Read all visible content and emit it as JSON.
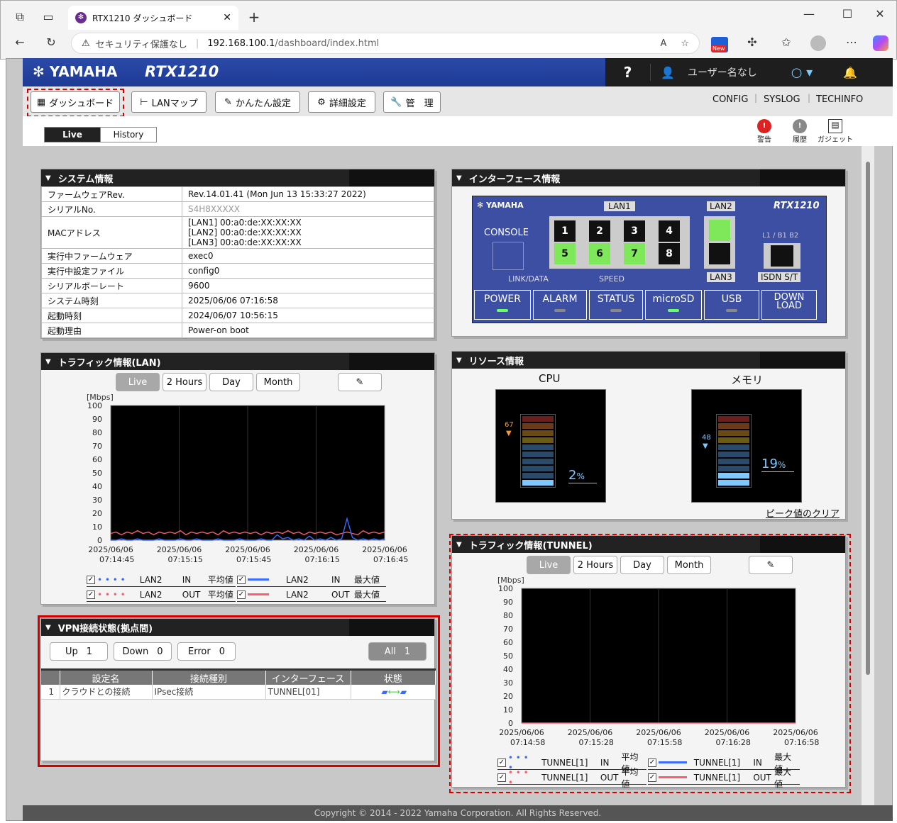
{
  "browser": {
    "tab_title": "RTX1210 ダッシュボード",
    "security": "セキュリティ保護なし",
    "url_host": "192.168.100.1",
    "url_path": "/dashboard/index.html",
    "new_badge": "New"
  },
  "header": {
    "brand": "YAMAHA",
    "model": "RTX1210",
    "help": "?",
    "user": "ユーザー名なし"
  },
  "nav": {
    "dashboard": "ダッシュボード",
    "lanmap": "LANマップ",
    "easy": "かんたん設定",
    "detail": "詳細設定",
    "manage": "管　理",
    "config": "CONFIG",
    "syslog": "SYSLOG",
    "techinfo": "TECHINFO"
  },
  "mode": {
    "live": "Live",
    "history": "History"
  },
  "tools": {
    "alert": "警告",
    "history": "履歴",
    "gadget": "ガジェット"
  },
  "system": {
    "title": "システム情報",
    "rows": [
      {
        "k": "ファームウェアRev.",
        "v": "Rev.14.01.41 (Mon Jun 13 15:33:27 2022)"
      },
      {
        "k": "シリアルNo.",
        "v": "S4H8XXXXX"
      },
      {
        "k": "MACアドレス",
        "v1": "[LAN1] 00:a0:de:XX:XX:XX",
        "v2": "[LAN2] 00:a0:de:XX:XX:XX",
        "v3": "[LAN3] 00:a0:de:XX:XX:XX"
      },
      {
        "k": "実行中ファームウェア",
        "v": "exec0"
      },
      {
        "k": "実行中設定ファイル",
        "v": "config0"
      },
      {
        "k": "シリアルボーレート",
        "v": "9600"
      },
      {
        "k": "システム時刻",
        "v": "2025/06/06 07:16:58"
      },
      {
        "k": "起動時刻",
        "v": "2024/06/07 10:56:15"
      },
      {
        "k": "起動理由",
        "v": "Power-on boot"
      }
    ]
  },
  "iface": {
    "title": "インターフェース情報",
    "brand": "YAMAHA",
    "model": "RTX1210",
    "console": "CONSOLE",
    "lan1": "LAN1",
    "lan2": "LAN2",
    "lan3": "LAN3",
    "isdn": "ISDN S/T",
    "l1": "L1 / B1 B2",
    "linkdata": "LINK/DATA",
    "speed": "SPEED",
    "ports": [
      "1",
      "2",
      "3",
      "4",
      "5",
      "6",
      "7",
      "8"
    ],
    "status": [
      {
        "n": "POWER",
        "on": true
      },
      {
        "n": "ALARM",
        "on": false
      },
      {
        "n": "STATUS",
        "on": false
      },
      {
        "n": "microSD",
        "on": true
      },
      {
        "n": "USB",
        "on": false
      },
      {
        "n": "DOWN LOAD",
        "on": false
      }
    ]
  },
  "traffic_lan": {
    "title": "トラフィック情報(LAN)",
    "btns": [
      "Live",
      "2 Hours",
      "Day",
      "Month"
    ],
    "unit": "[Mbps]",
    "legend": [
      {
        "a": "LAN2",
        "b": "IN",
        "c": "平均値"
      },
      {
        "a": "LAN2",
        "b": "IN",
        "c": "最大値"
      },
      {
        "a": "LAN2",
        "b": "OUT",
        "c": "平均値"
      },
      {
        "a": "LAN2",
        "b": "OUT",
        "c": "最大値"
      }
    ]
  },
  "traffic_tunnel": {
    "title": "トラフィック情報(TUNNEL)",
    "btns": [
      "Live",
      "2 Hours",
      "Day",
      "Month"
    ],
    "unit": "[Mbps]",
    "legend": [
      {
        "a": "TUNNEL[1]",
        "b": "IN",
        "c": "平均値"
      },
      {
        "a": "TUNNEL[1]",
        "b": "IN",
        "c": "最大値"
      },
      {
        "a": "TUNNEL[1]",
        "b": "OUT",
        "c": "平均値"
      },
      {
        "a": "TUNNEL[1]",
        "b": "OUT",
        "c": "最大値"
      }
    ]
  },
  "resource": {
    "title": "リソース情報",
    "cpu": "CPU",
    "mem": "メモリ",
    "cpu_peak": "67",
    "cpu_val": "2",
    "mem_peak": "48",
    "mem_val": "19",
    "pct": "%",
    "clear": "ピーク値のクリア"
  },
  "vpn": {
    "title": "VPN接続状態(拠点間)",
    "up": "Up",
    "up_n": "1",
    "down": "Down",
    "down_n": "0",
    "err": "Error",
    "err_n": "0",
    "all": "All",
    "all_n": "1",
    "cols": [
      "設定名",
      "接続種別",
      "インターフェース",
      "状態"
    ],
    "rows": [
      {
        "no": "1",
        "name": "クラウドとの接続",
        "type": "IPsec接続",
        "iface": "TUNNEL[01]"
      }
    ]
  },
  "footer": "Copyright © 2014 - 2022 Yamaha Corporation. All Rights Reserved.",
  "chart_data": [
    {
      "type": "line",
      "title": "トラフィック情報(LAN)",
      "ylabel": "[Mbps]",
      "ylim": [
        0,
        100
      ],
      "yticks": [
        0,
        10,
        20,
        30,
        40,
        50,
        60,
        70,
        80,
        90,
        100
      ],
      "x": [
        "2025/06/06 07:14:45",
        "2025/06/06 07:15:15",
        "2025/06/06 07:15:45",
        "2025/06/06 07:16:15",
        "2025/06/06 07:16:45"
      ],
      "series": [
        {
          "name": "LAN2 OUT 最大値",
          "color": "#ff5a6e",
          "values": [
            5,
            6,
            4,
            6,
            5,
            7,
            5,
            6,
            4,
            6,
            5,
            6,
            5,
            7,
            4,
            6,
            5,
            6,
            5,
            6,
            4,
            7,
            5,
            6,
            5,
            6,
            5,
            6,
            4,
            6,
            5,
            6,
            5,
            7,
            5,
            6,
            4,
            6,
            5,
            6,
            5,
            6,
            4,
            5,
            6,
            5,
            4,
            7,
            5,
            6,
            5,
            6
          ]
        },
        {
          "name": "LAN2 IN 最大値",
          "color": "#3a6bff",
          "values": [
            0,
            0,
            1,
            0,
            0,
            1,
            0,
            0,
            0,
            1,
            0,
            0,
            0,
            1,
            0,
            0,
            1,
            0,
            0,
            0,
            1,
            0,
            0,
            0,
            1,
            0,
            0,
            0,
            1,
            0,
            0,
            4,
            1,
            2,
            0,
            1,
            0,
            3,
            0,
            1,
            0,
            2,
            0,
            1,
            16,
            2,
            0,
            1,
            0,
            1,
            0,
            1
          ]
        }
      ]
    },
    {
      "type": "line",
      "title": "トラフィック情報(TUNNEL)",
      "ylabel": "[Mbps]",
      "ylim": [
        0,
        100
      ],
      "yticks": [
        0,
        10,
        20,
        30,
        40,
        50,
        60,
        70,
        80,
        90,
        100
      ],
      "x": [
        "2025/06/06 07:14:58",
        "2025/06/06 07:15:28",
        "2025/06/06 07:15:58",
        "2025/06/06 07:16:28",
        "2025/06/06 07:16:58"
      ],
      "series": [
        {
          "name": "TUNNEL[1] OUT 最大値",
          "color": "#ff5a6e",
          "values": [
            0,
            0,
            0,
            0,
            0,
            0,
            0,
            0,
            0,
            0
          ]
        }
      ]
    }
  ],
  "colors": {
    "header_blue": "#2b4aa8",
    "highlight_red": "#d40000",
    "led_green": "#66ff66"
  }
}
